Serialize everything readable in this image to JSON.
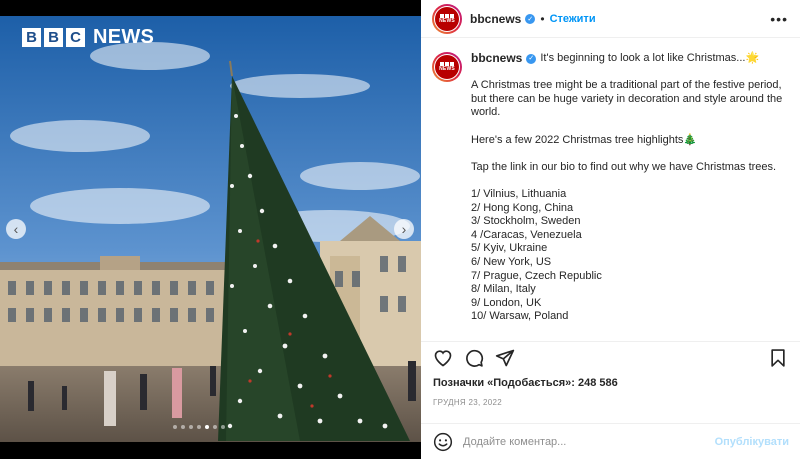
{
  "colors": {
    "accent": "#0095f6",
    "verified": "#3897f0",
    "bbc_red": "#b80000",
    "text": "#262626",
    "muted": "#8e8e8e"
  },
  "media": {
    "watermark": {
      "letters": [
        "B",
        "B",
        "C"
      ],
      "word": "NEWS"
    },
    "carousel": {
      "slide_count": 7,
      "active_index": 4
    },
    "prev_icon": "chevron-left-icon",
    "next_icon": "chevron-right-icon"
  },
  "header": {
    "avatar_text": "NEWS",
    "username": "bbcnews",
    "separator": "•",
    "follow_label": "Стежити",
    "more_icon": "more-horizontal-icon"
  },
  "caption": {
    "username": "bbcnews",
    "first_line": "It's beginning to look a lot like Christmas...",
    "first_emoji": "🌟",
    "paragraph1": "A Christmas tree might be a traditional part of the festive period, but there can be huge variety in decoration and style around the world.",
    "paragraph2": "Here's a few 2022 Christmas tree highlights",
    "paragraph2_emoji": "🎄",
    "paragraph3": "Tap the link in our bio to find out why we have Christmas trees.",
    "list": [
      "1/ Vilnius, Lithuania",
      "2/ Hong Kong, China",
      "3/ Stockholm, Sweden",
      "4 /Caracas, Venezuela",
      "5/ Kyiv, Ukraine",
      "6/ New York, US",
      "7/ Prague, Czech Republic",
      "8/ Milan, Italy",
      "9/ London, UK",
      "10/ Warsaw, Poland"
    ]
  },
  "actions": {
    "like_icon": "heart-icon",
    "comment_icon": "comment-icon",
    "share_icon": "share-icon",
    "save_icon": "bookmark-icon"
  },
  "likes_text": "Позначки «Подобається»: 248 586",
  "date_text": "ГРУДНЯ 23, 2022",
  "comment": {
    "emoji_icon": "smiley-icon",
    "placeholder": "Додайте коментар...",
    "publish_label": "Опублікувати"
  }
}
